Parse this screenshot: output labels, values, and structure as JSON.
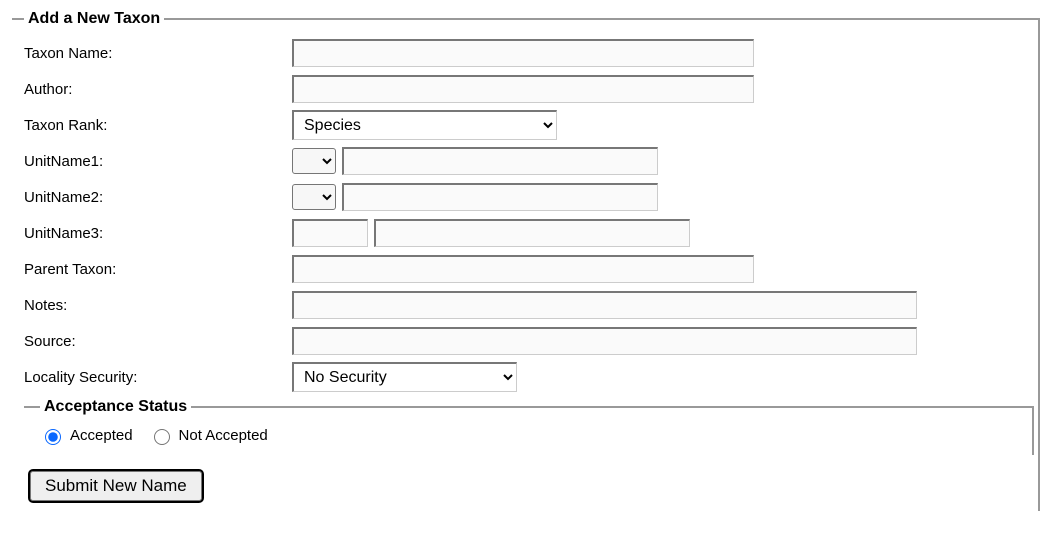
{
  "form": {
    "legend": "Add a New Taxon",
    "labels": {
      "taxon_name": "Taxon Name:",
      "author": "Author:",
      "taxon_rank": "Taxon Rank:",
      "unitname1": "UnitName1:",
      "unitname2": "UnitName2:",
      "unitname3": "UnitName3:",
      "parent_taxon": "Parent Taxon:",
      "notes": "Notes:",
      "source": "Source:",
      "locality_security": "Locality Security:"
    },
    "values": {
      "taxon_name": "",
      "author": "",
      "taxon_rank": "Species",
      "unitname1_prefix": "",
      "unitname1": "",
      "unitname2_prefix": "",
      "unitname2": "",
      "unitname3_prefix": "",
      "unitname3": "",
      "parent_taxon": "",
      "notes": "",
      "source": "",
      "locality_security": "No Security"
    },
    "rank_options": [
      "Species"
    ],
    "security_options": [
      "No Security"
    ],
    "acceptance": {
      "legend": "Acceptance Status",
      "accepted_label": "Accepted",
      "not_accepted_label": "Not Accepted",
      "selected": "accepted"
    },
    "submit_label": "Submit New Name"
  }
}
